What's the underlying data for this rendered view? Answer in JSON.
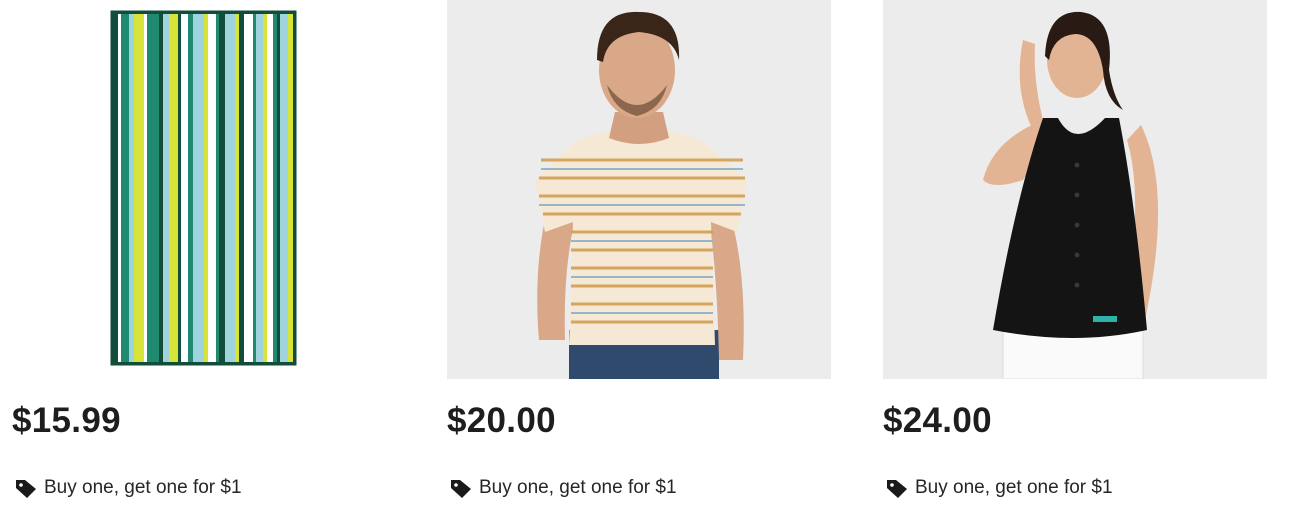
{
  "products": [
    {
      "image_alt": "striped-beach-towel",
      "price": "$15.99",
      "promo_label": "Buy one, get one for $1",
      "promo_icon": "tag-icon"
    },
    {
      "image_alt": "man-in-striped-tee",
      "price": "$20.00",
      "promo_label": "Buy one, get one for $1",
      "promo_icon": "tag-icon"
    },
    {
      "image_alt": "woman-in-black-tank",
      "price": "$24.00",
      "promo_label": "Buy one, get one for $1",
      "promo_icon": "tag-icon"
    }
  ],
  "colors": {
    "price_text": "#1e1e1e",
    "promo_text": "#262626",
    "photo_background": "#ececec",
    "towel_green": "#1f8a70",
    "towel_yellow": "#d8e33a",
    "towel_dark": "#124d3b",
    "towel_light_blue": "#9fd3de"
  }
}
